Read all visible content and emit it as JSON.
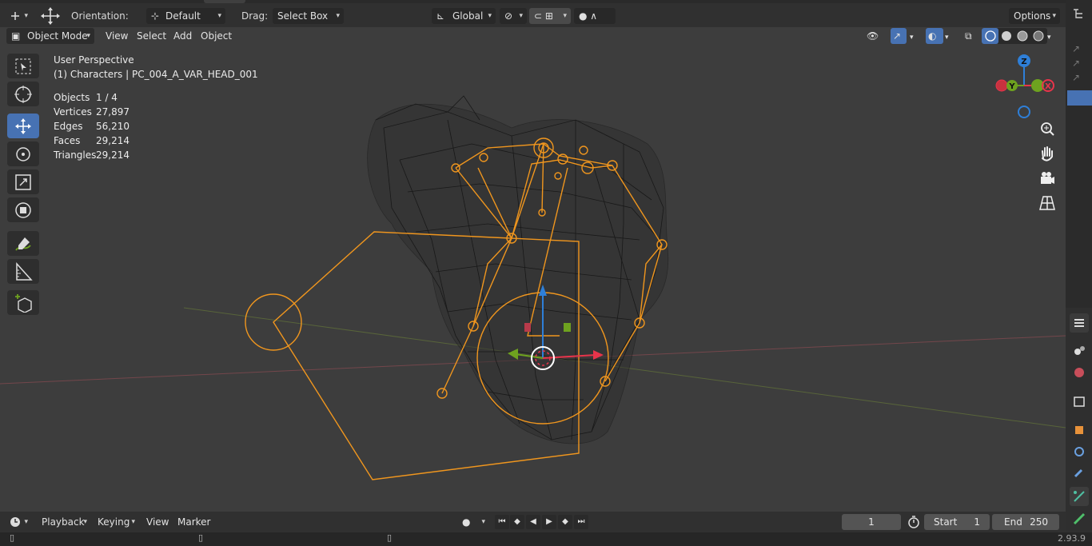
{
  "header": {
    "orientation_label": "Orientation:",
    "orientation_value": "Default",
    "drag_label": "Drag:",
    "drag_value": "Select Box",
    "transform_space": "Global",
    "options_label": "Options"
  },
  "view_header": {
    "mode": "Object Mode",
    "menus": [
      "View",
      "Select",
      "Add",
      "Object"
    ]
  },
  "overlay": {
    "perspective": "User Perspective",
    "collection": "(1) Characters | PC_004_A_VAR_HEAD_001",
    "stats": [
      {
        "label": "Objects",
        "value": "1 / 4"
      },
      {
        "label": "Vertices",
        "value": "27,897"
      },
      {
        "label": "Edges",
        "value": "56,210"
      },
      {
        "label": "Faces",
        "value": "29,214"
      },
      {
        "label": "Triangles",
        "value": "29,214"
      }
    ]
  },
  "gizmo": {
    "z": "Z",
    "y": "Y",
    "x": "X"
  },
  "timeline": {
    "menus": [
      "Playback",
      "Keying",
      "View",
      "Marker"
    ],
    "current_frame": "1",
    "start_label": "Start",
    "start_value": "1",
    "end_label": "End",
    "end_value": "250"
  },
  "status": {
    "version": "2.93.9"
  },
  "colors": {
    "accent": "#4772b3",
    "armature": "#f0961e",
    "axis_x": "#e8344b",
    "axis_y": "#6ea21f",
    "axis_z": "#2e7fd8"
  },
  "icons": {
    "select": "select-box-icon",
    "cursor": "cursor-icon",
    "move": "move-icon",
    "rotate": "rotate-icon",
    "scale": "scale-icon",
    "transform": "transform-icon",
    "annotate": "annotate-icon",
    "measure": "measure-icon",
    "add_cube": "add-cube-icon"
  }
}
